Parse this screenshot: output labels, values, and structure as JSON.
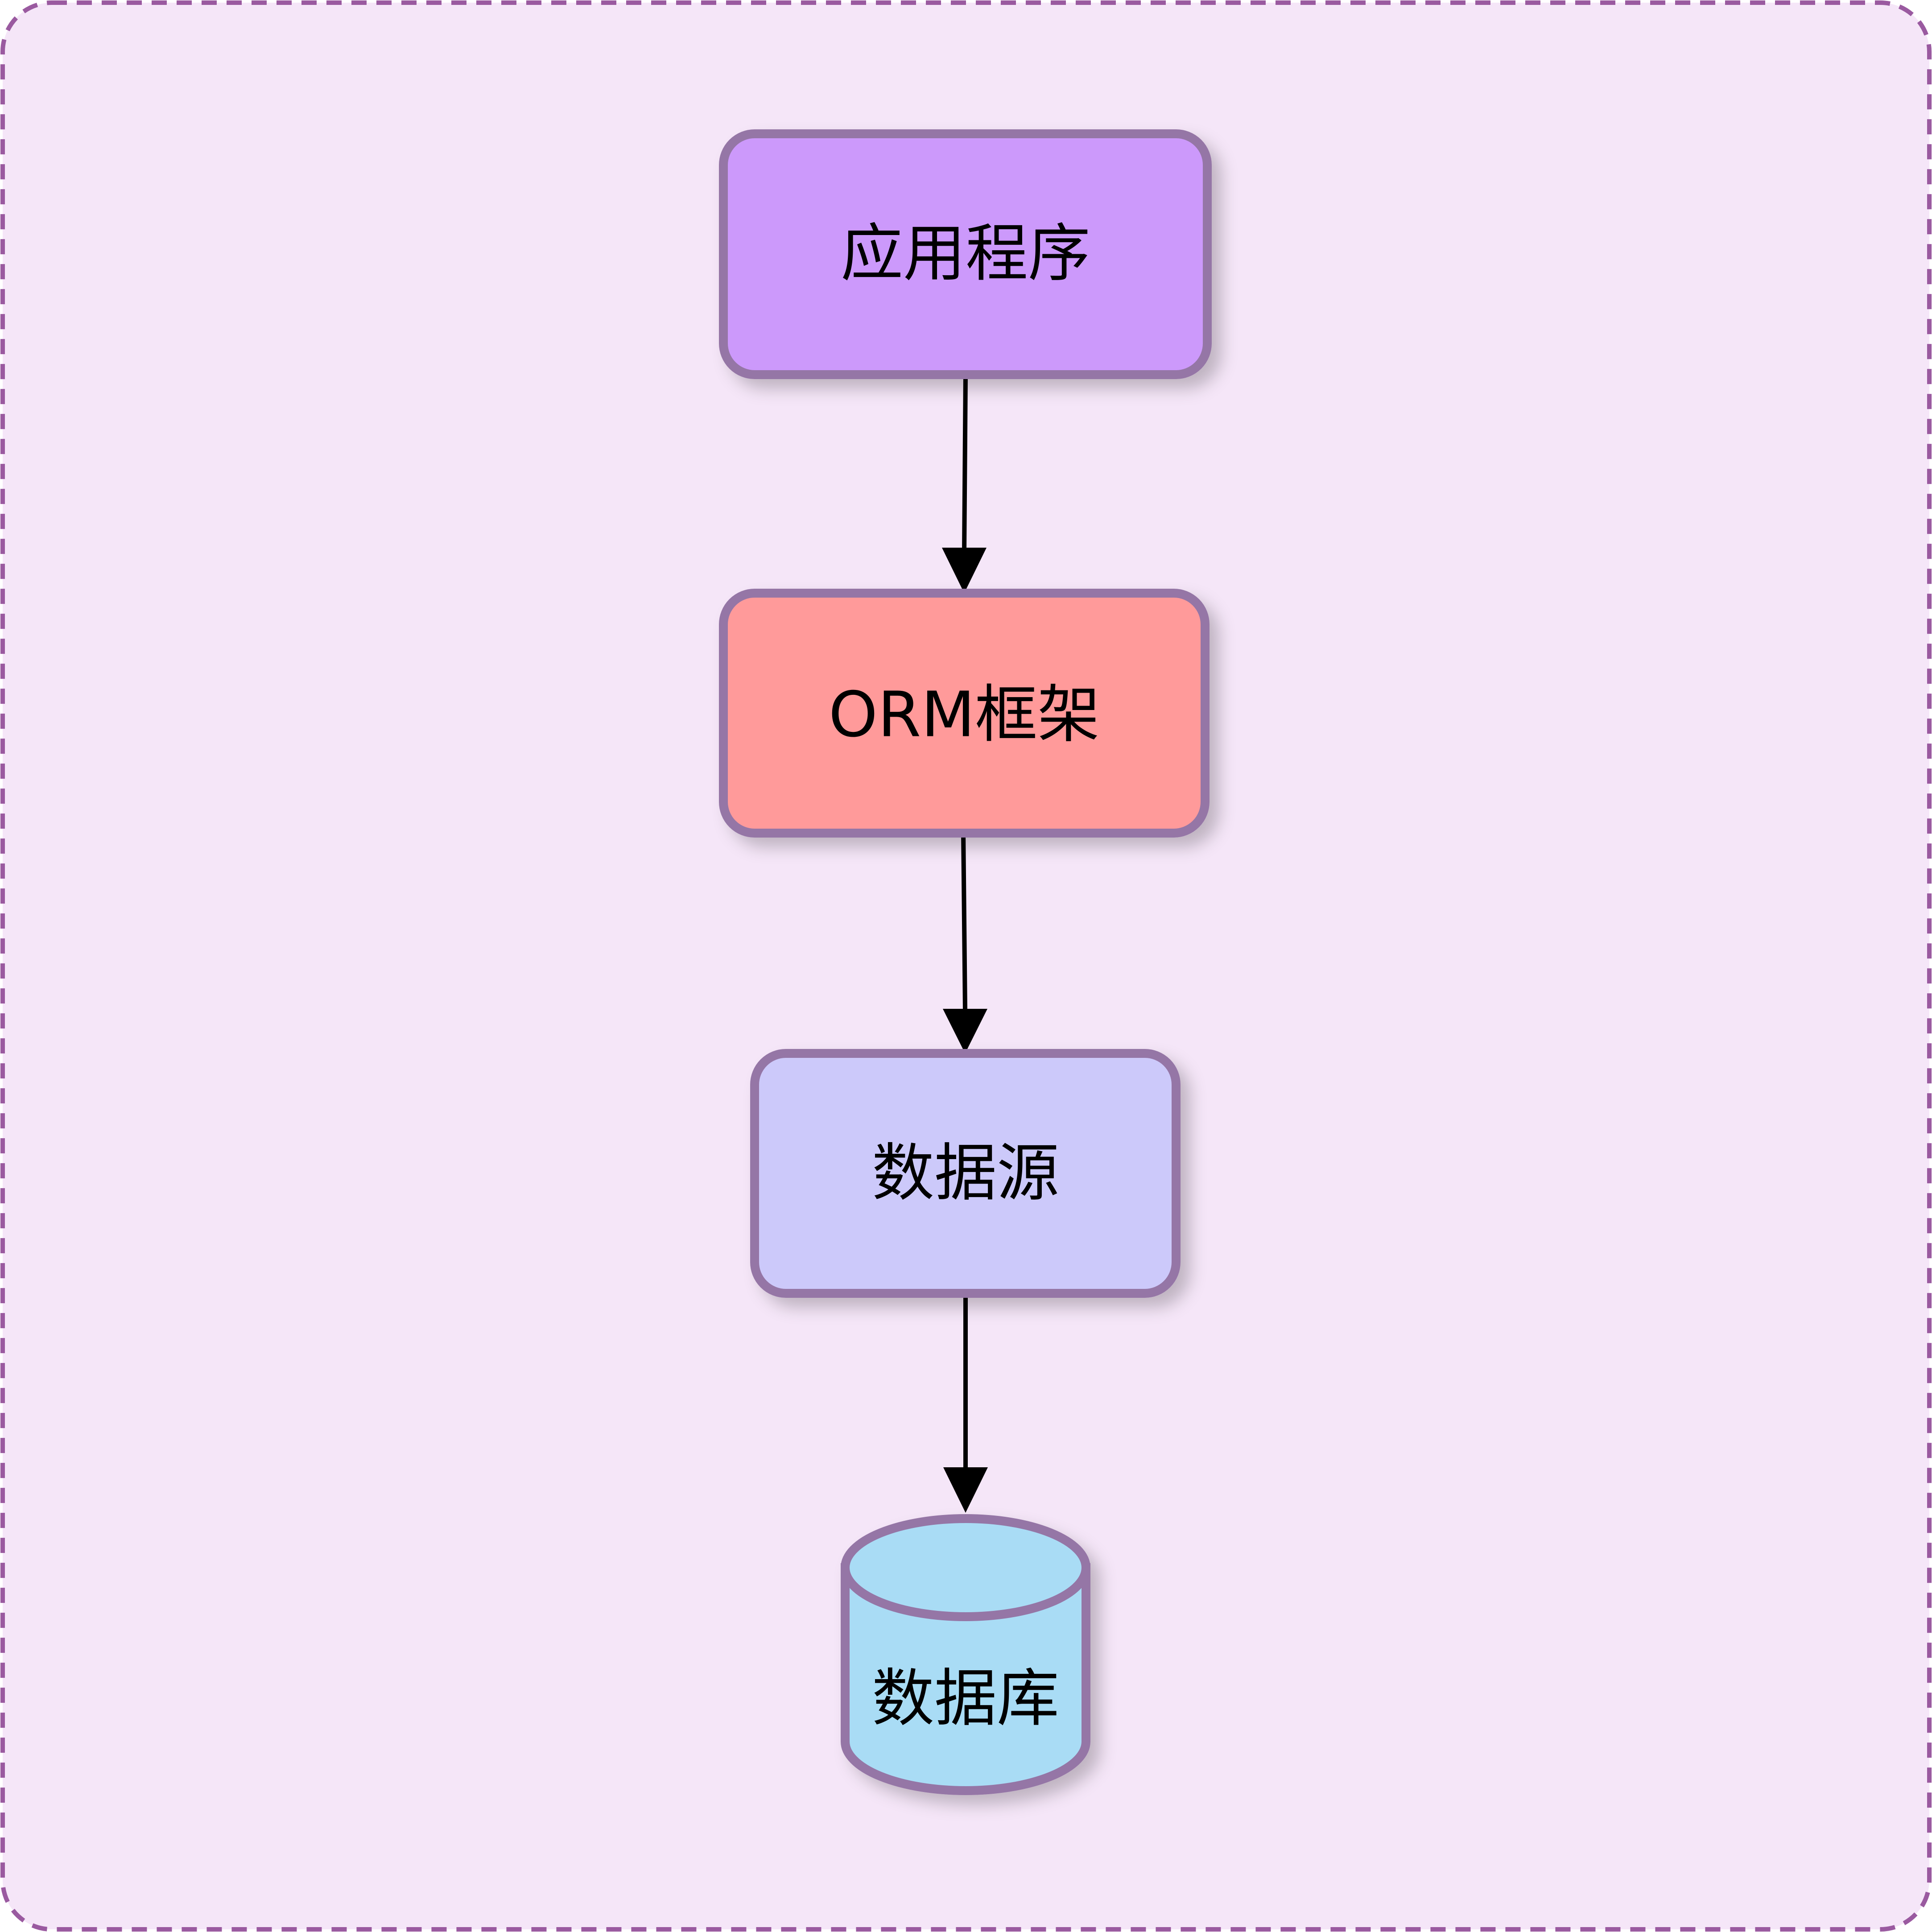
{
  "diagram": {
    "background_color": "#f5e6f8",
    "border_color": "#9a5aa0",
    "node_stroke_color": "#9576a6",
    "arrow_color": "#000000",
    "nodes": {
      "app": {
        "label": "应用程序",
        "fill": "#cc99fb"
      },
      "orm": {
        "label": "ORM框架",
        "fill": "#ff9a9a"
      },
      "datasource": {
        "label": "数据源",
        "fill": "#ccc9fa"
      },
      "database": {
        "label": "数据库",
        "fill": "#a9dcf5",
        "shape": "cylinder-icon"
      }
    },
    "edges": [
      {
        "from": "app",
        "to": "orm"
      },
      {
        "from": "orm",
        "to": "datasource"
      },
      {
        "from": "datasource",
        "to": "database"
      }
    ]
  }
}
